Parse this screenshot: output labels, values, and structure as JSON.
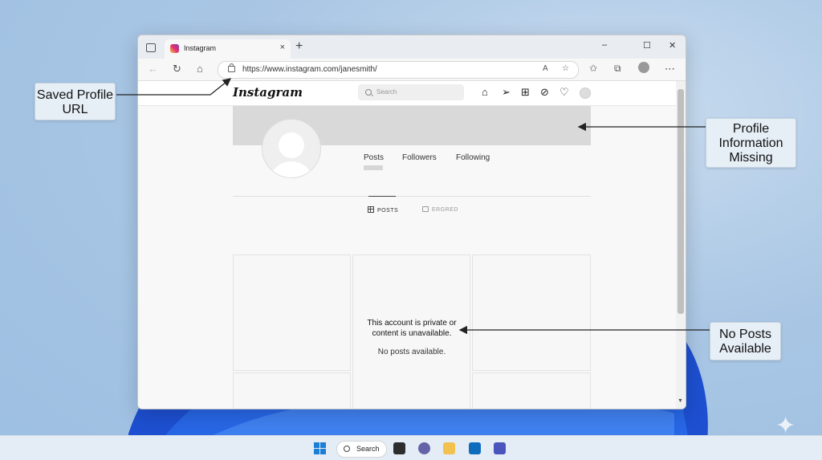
{
  "browser": {
    "tab_title": "Instagram",
    "tab_close": "×",
    "new_tab": "+",
    "url": "https://www.instagram.com/janesmith/",
    "window_controls": [
      "–",
      "☐",
      "✕"
    ]
  },
  "instagram": {
    "logo": "Instagram",
    "search_placeholder": "Search",
    "stats": [
      "Posts",
      "Followers",
      "Following"
    ],
    "tabs": [
      "POSTS",
      "ERGRED"
    ],
    "empty_message": "This account is private or content is unavailable.",
    "empty_sub": "No posts available."
  },
  "callouts": {
    "saved_url": "Saved Profile URL",
    "profile_missing": "Profile Information Missing",
    "no_posts": "No Posts Available"
  },
  "taskbar": {
    "search_label": "Search"
  },
  "colors": {
    "accent": "#1c7fd6",
    "desktop": "#a9c6e4",
    "cover": "#d9d9d9"
  }
}
